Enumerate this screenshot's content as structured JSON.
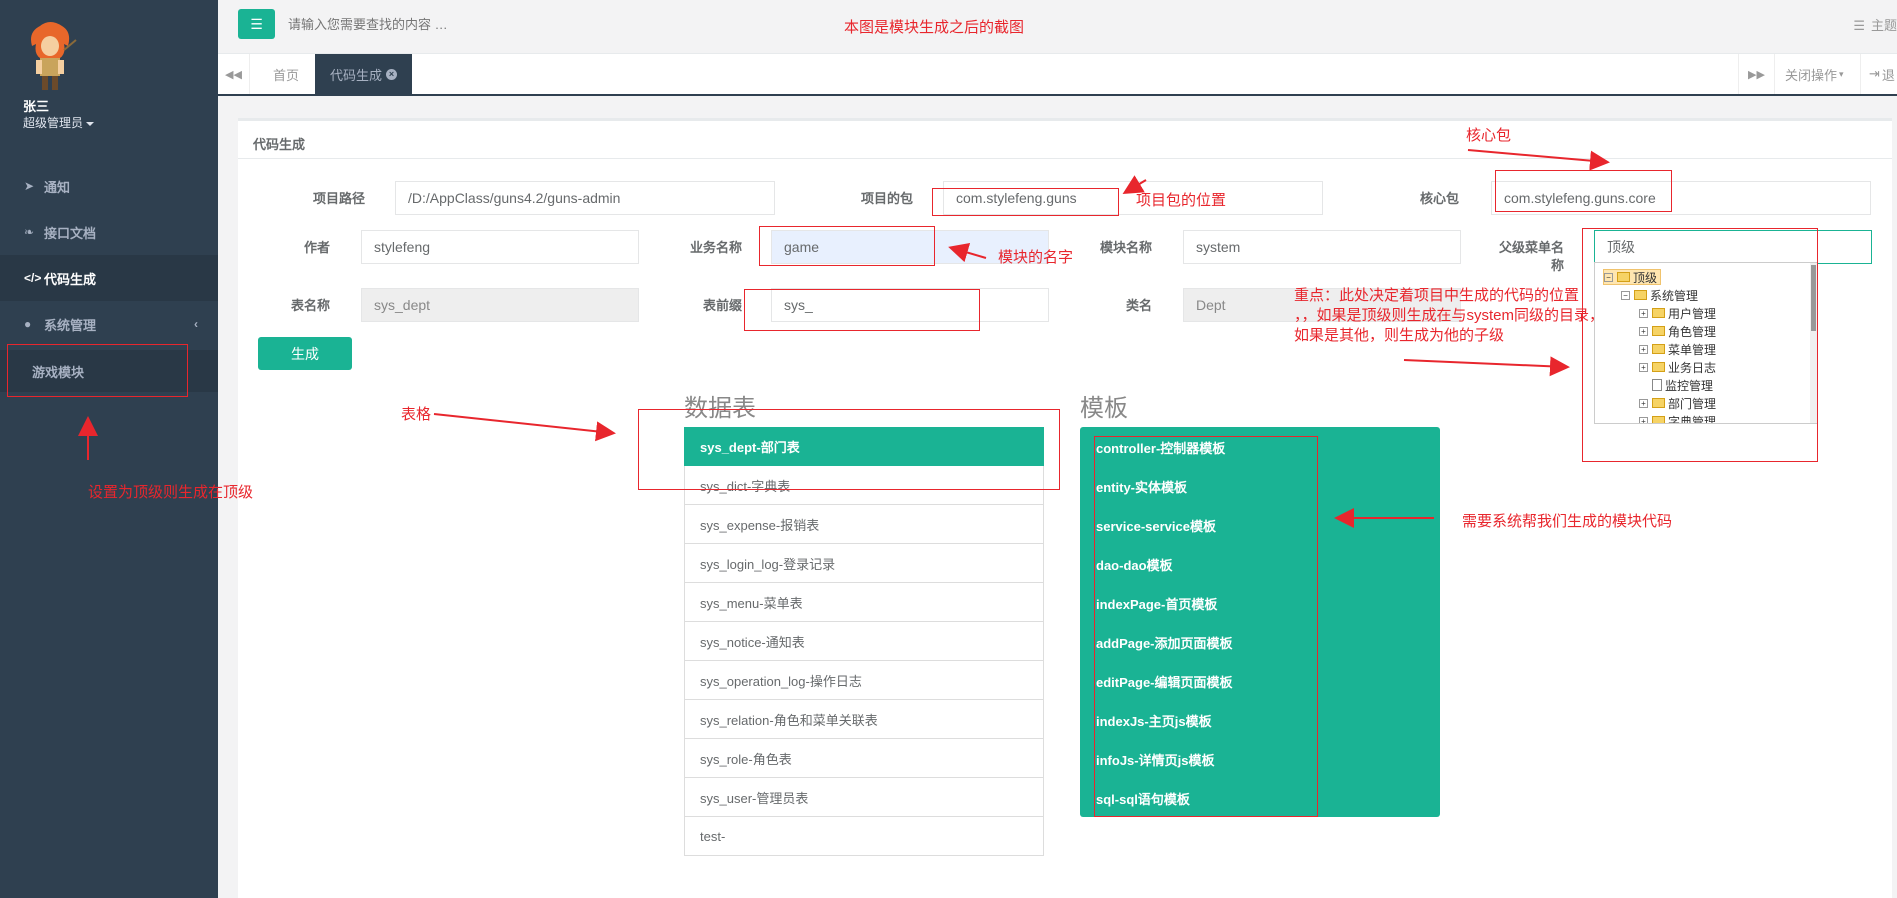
{
  "sidebar": {
    "user_name": "张三",
    "user_role": "超级管理员",
    "items": [
      {
        "label": "通知",
        "icon": "paper-plane-icon"
      },
      {
        "label": "接口文档",
        "icon": "leaf-icon"
      },
      {
        "label": "代码生成",
        "icon": "code-icon"
      },
      {
        "label": "系统管理",
        "icon": "user-icon"
      }
    ],
    "sub_item": "游戏模块"
  },
  "topbar": {
    "search_placeholder": "请输入您需要查找的内容 …",
    "theme_label": "主题"
  },
  "tabs": {
    "home": "首页",
    "active": "代码生成",
    "close_ops": "关闭操作",
    "exit": "退"
  },
  "panel": {
    "title": "代码生成",
    "fields": {
      "project_path_label": "项目路径",
      "project_path_value": "/D:/AppClass/guns4.2/guns-admin",
      "project_package_label": "项目的包",
      "project_package_value": "com.stylefeng.guns",
      "core_package_label": "核心包",
      "core_package_value": "com.stylefeng.guns.core",
      "author_label": "作者",
      "author_value": "stylefeng",
      "biz_name_label": "业务名称",
      "biz_name_value": "game",
      "module_name_label": "模块名称",
      "module_name_value": "system",
      "parent_menu_label_1": "父级菜单名",
      "parent_menu_label_2": "称",
      "parent_menu_value": "顶级",
      "table_name_label": "表名称",
      "table_name_value": "sys_dept",
      "table_prefix_label": "表前缀",
      "table_prefix_value": "sys_",
      "class_name_label": "类名",
      "class_name_value": "Dept"
    },
    "generate_button": "生成",
    "tables_title": "数据表",
    "tables": [
      "sys_dept-部门表",
      "sys_dict-字典表",
      "sys_expense-报销表",
      "sys_login_log-登录记录",
      "sys_menu-菜单表",
      "sys_notice-通知表",
      "sys_operation_log-操作日志",
      "sys_relation-角色和菜单关联表",
      "sys_role-角色表",
      "sys_user-管理员表",
      "test-"
    ],
    "templates_title": "模板",
    "templates": [
      "controller-控制器模板",
      "entity-实体模板",
      "service-service模板",
      "dao-dao模板",
      "indexPage-首页模板",
      "addPage-添加页面模板",
      "editPage-编辑页面模板",
      "indexJs-主页js模板",
      "infoJs-详情页js模板",
      "sql-sql语句模板"
    ],
    "tree": [
      {
        "label": "顶级",
        "level": 0,
        "toggle": "−",
        "type": "folder",
        "selected": true
      },
      {
        "label": "系统管理",
        "level": 1,
        "toggle": "−",
        "type": "folder"
      },
      {
        "label": "用户管理",
        "level": 2,
        "toggle": "+",
        "type": "folder"
      },
      {
        "label": "角色管理",
        "level": 2,
        "toggle": "+",
        "type": "folder"
      },
      {
        "label": "菜单管理",
        "level": 2,
        "toggle": "+",
        "type": "folder"
      },
      {
        "label": "业务日志",
        "level": 2,
        "toggle": "+",
        "type": "folder"
      },
      {
        "label": "监控管理",
        "level": 2,
        "toggle": "",
        "type": "file"
      },
      {
        "label": "部门管理",
        "level": 2,
        "toggle": "+",
        "type": "folder"
      },
      {
        "label": "字典管理",
        "level": 2,
        "toggle": "+",
        "type": "folder"
      }
    ]
  },
  "annotations": {
    "top_note": "本图是模块生成之后的截图",
    "core_pkg": "核心包",
    "project_pkg_pos": "项目包的位置",
    "module_name": "模块的名字",
    "key_point_1": "重点：此处决定着项目中生成的代码的位置",
    "key_point_2": "，，如果是顶级则生成在与system同级的目录，",
    "key_point_3": "如果是其他，则生成为他的子级",
    "table_note": "表格",
    "template_note": "需要系统帮我们生成的模块代码",
    "top_level_note": "设置为顶级则生成在顶级"
  },
  "colors": {
    "sidebar_bg": "#2f4050",
    "accent": "#1ab394",
    "annotation": "#e8262d"
  }
}
